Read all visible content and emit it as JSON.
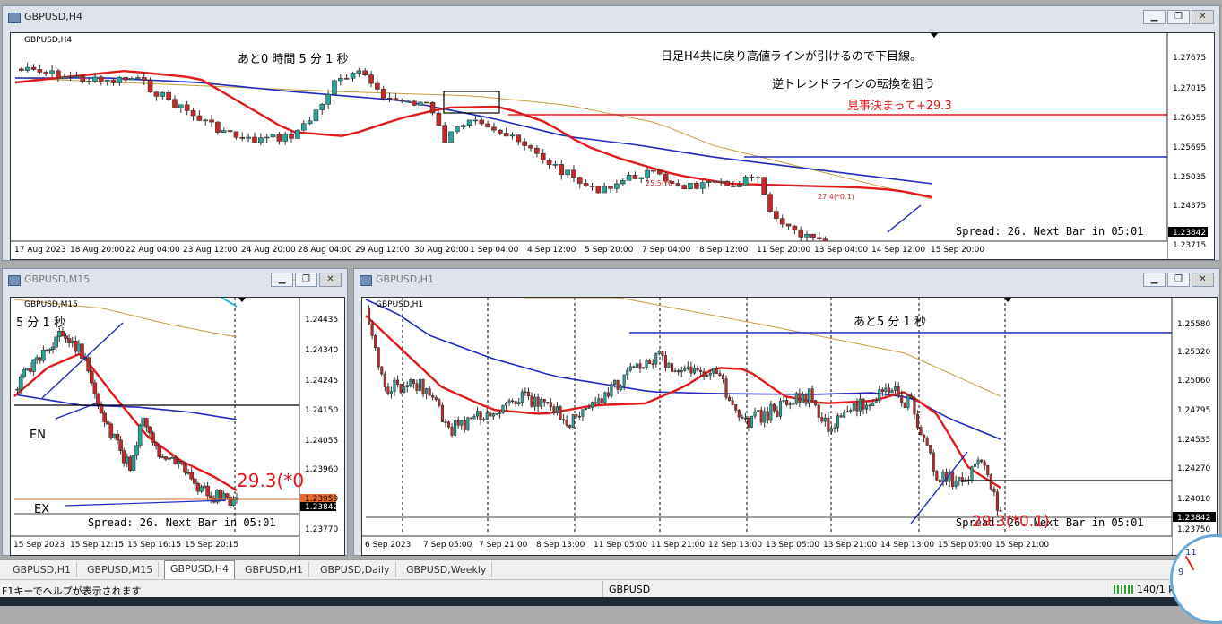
{
  "windows": {
    "h4": {
      "title": "GBPUSD,H4",
      "symbol_label": "GBPUSD,H4",
      "texts": {
        "countdown": "あと0 時間 5 分 1 秒",
        "note1": "日足H4共に戻り高値ラインが引けるので下目線。",
        "note2": "逆トレンドラインの転換を狙う",
        "note3": "見事決まって+29.3",
        "spread": "Spread: 26. Next Bar in 05:01",
        "small1": "27.4(*0.1)",
        "small2": "25.5(*0"
      },
      "prices": [
        "1.27675",
        "1.27015",
        "1.26355",
        "1.25695",
        "1.25035",
        "1.24375",
        "1.23842",
        "1.23715"
      ],
      "times": [
        "17 Aug 2023",
        "18 Aug 20:00",
        "22 Aug 04:00",
        "23 Aug 12:00",
        "24 Aug 20:00",
        "28 Aug 04:00",
        "29 Aug 12:00",
        "30 Aug 20:00",
        "1 Sep 04:00",
        "4 Sep 12:00",
        "5 Sep 20:00",
        "7 Sep 04:00",
        "8 Sep 12:00",
        "11 Sep 20:00",
        "13 Sep 04:00",
        "14 Sep 12:00",
        "15 Sep 20:00"
      ]
    },
    "m15": {
      "title": "GBPUSD,M15",
      "symbol_label": "GBPUSD,M15",
      "texts": {
        "countdown": "5 分 1 秒",
        "en": "EN",
        "ex": "EX",
        "profit": "29.3(*0",
        "spread": "Spread: 26. Next Bar in 05:01"
      },
      "prices": [
        "1.24435",
        "1.24340",
        "1.24245",
        "1.24150",
        "1.24055",
        "1.23960",
        "1.23959",
        "1.23842",
        "1.23770"
      ],
      "times": [
        "15 Sep 2023",
        "15 Sep 12:15",
        "15 Sep 16:15",
        "15 Sep 20:15"
      ]
    },
    "h1": {
      "title": "GBPUSD,H1",
      "symbol_label": "GBPUSD,H1",
      "texts": {
        "countdown": "あと5 分 1 秒",
        "spread": "Spread: 26. Next Bar in 05:01",
        "profit": "29.3(*0.1)"
      },
      "prices": [
        "1.25580",
        "1.25320",
        "1.25060",
        "1.24795",
        "1.24535",
        "1.24270",
        "1.24010",
        "1.23842",
        "1.23750"
      ],
      "times": [
        "6 Sep 2023",
        "7 Sep 05:00",
        "7 Sep 21:00",
        "8 Sep 13:00",
        "11 Sep 05:00",
        "11 Sep 21:00",
        "12 Sep 13:00",
        "13 Sep 05:00",
        "13 Sep 21:00",
        "14 Sep 13:00",
        "15 Sep 05:00",
        "15 Sep 21:00"
      ]
    }
  },
  "tabs": [
    "GBPUSD,H1",
    "GBPUSD,M15",
    "GBPUSD,H4",
    "GBPUSD,H1",
    "GBPUSD,Daily",
    "GBPUSD,Weekly"
  ],
  "active_tab": 2,
  "status": {
    "help": "F1キーでヘルプが表示されます",
    "symbol": "GBPUSD",
    "traffic": "140/1 k"
  },
  "colors": {
    "bull": "#26a69a",
    "bear": "#c62828",
    "ma_fast": "#e31a1c",
    "ma_mid": "#1f2bbf",
    "ma_slow": "#c89c3c",
    "line_red": "#e31a1c",
    "line_blue": "#1f2bbf"
  }
}
